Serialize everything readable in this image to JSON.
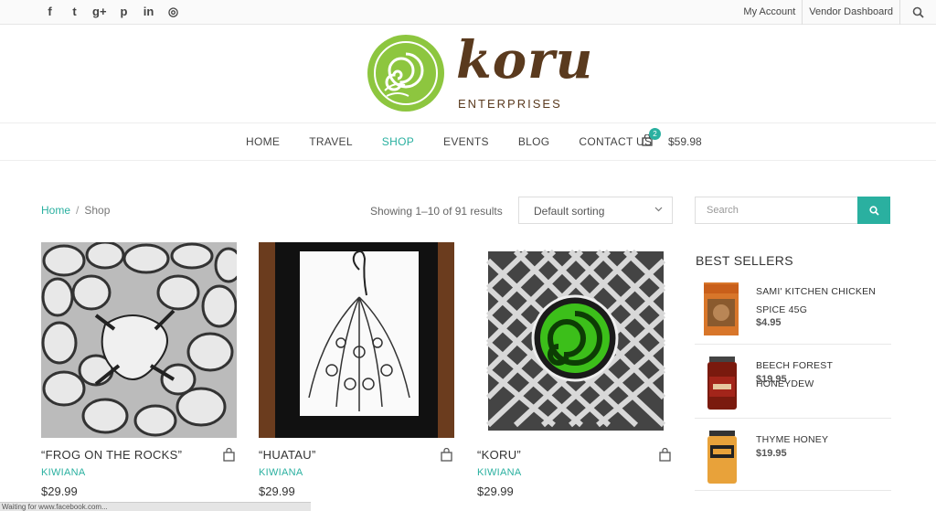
{
  "topbar": {
    "social_icons": [
      "facebook-icon",
      "twitter-icon",
      "google-plus-icon",
      "pinterest-icon",
      "linkedin-icon",
      "instagram-icon"
    ],
    "social_glyphs": [
      "f",
      "t",
      "g+",
      "p",
      "in",
      "◎"
    ],
    "links": [
      "My Account",
      "Vendor Dashboard"
    ]
  },
  "brand": {
    "name": "koru",
    "sub": "ENTERPRISES",
    "logo_green": "#8dc63f",
    "logo_brown": "#5a3a1e"
  },
  "nav": {
    "items": [
      "HOME",
      "TRAVEL",
      "SHOP",
      "EVENTS",
      "BLOG",
      "CONTACT US"
    ],
    "active": "SHOP",
    "cart_count": "2",
    "cart_total": "$59.98"
  },
  "shop": {
    "breadcrumb_home": "Home",
    "breadcrumb_sep": "/",
    "breadcrumb_current": "Shop",
    "results_text": "Showing 1–10 of 91 results",
    "sorting": "Default sorting",
    "accent": "#2ab0a0"
  },
  "products": [
    {
      "title": "“FROG ON THE ROCKS”",
      "category": "KIWIANA",
      "price": "$29.99"
    },
    {
      "title": "“HUATAU”",
      "category": "KIWIANA",
      "price": "$29.99"
    },
    {
      "title": "“KORU”",
      "category": "KIWIANA",
      "price": "$29.99"
    }
  ],
  "sidebar": {
    "search_placeholder": "Search",
    "best_sellers_title": "BEST SELLERS",
    "items": [
      {
        "name": "SAMI' KITCHEN CHICKEN SPICE 45G",
        "price": "$4.95"
      },
      {
        "name": "BEECH FOREST HONEYDEW",
        "price": "$19.95"
      },
      {
        "name": "THYME HONEY",
        "price": "$19.95"
      }
    ]
  },
  "status": "Waiting for www.facebook.com..."
}
